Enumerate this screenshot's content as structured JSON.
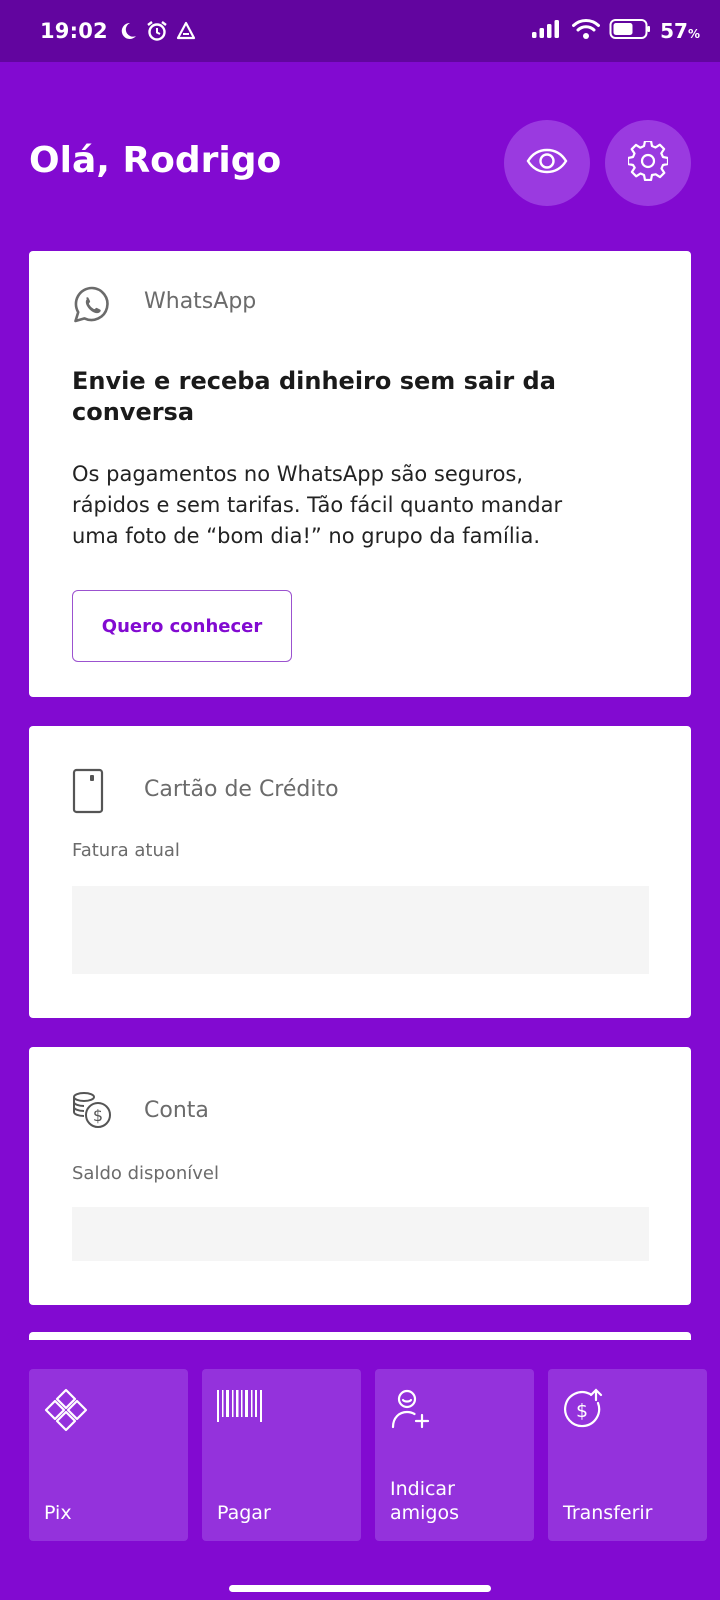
{
  "status_bar": {
    "time": "19:02",
    "battery_percent": "57",
    "battery_unit": "%",
    "icons_left": [
      "moon-icon",
      "alarm-icon",
      "nav-arrow-icon"
    ],
    "icons_right": [
      "signal-icon",
      "wifi-icon",
      "battery-icon"
    ]
  },
  "header": {
    "greeting": "Olá, Rodrigo",
    "buttons": [
      "eye-icon",
      "gear-icon"
    ]
  },
  "whatsapp_card": {
    "icon": "whatsapp-icon",
    "label": "WhatsApp",
    "title": "Envie e receba dinheiro sem sair da conversa",
    "body": "Os pagamentos no WhatsApp são seguros, rápidos e sem tarifas. Tão fácil quanto mandar uma foto de “bom dia!” no grupo da família.",
    "button_label": "Quero conhecer"
  },
  "credit_card": {
    "icon": "credit-card-icon",
    "label": "Cartão de Crédito",
    "subtitle": "Fatura atual"
  },
  "account_card": {
    "icon": "coins-icon",
    "label": "Conta",
    "subtitle": "Saldo disponível"
  },
  "shortcuts": [
    {
      "label": "Pix",
      "icon": "pix-icon"
    },
    {
      "label": "Pagar",
      "icon": "barcode-icon"
    },
    {
      "label": "Indicar amigos",
      "icon": "add-friend-icon"
    },
    {
      "label": "Transferir",
      "icon": "transfer-icon"
    }
  ],
  "colors": {
    "brand": "#820ad1",
    "status_bar": "#62059f",
    "shortcut_bg": "#9432dc"
  }
}
